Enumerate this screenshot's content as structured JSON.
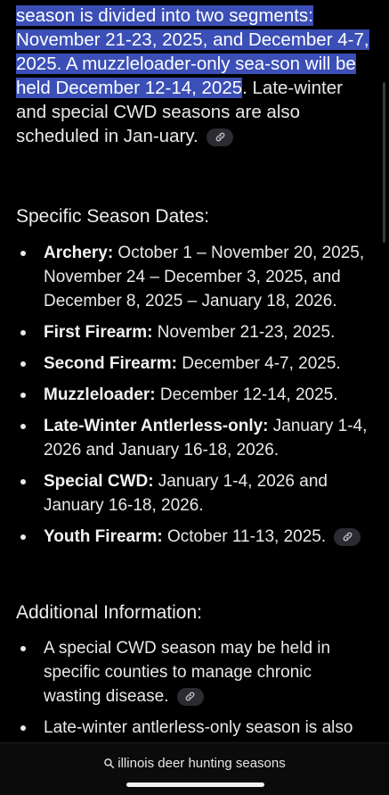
{
  "intro": {
    "highlighted": "season is divided into two segments: November 21-23, 2025, and December 4-7, 2025. A muzzleloader-only sea-son will be held December 12-14, 2025",
    "rest": ". Late-winter and special CWD seasons are also scheduled in Jan-uary."
  },
  "specific": {
    "heading": "Specific Season Dates:",
    "items": [
      {
        "label": "Archery:",
        "text": " October 1 – November 20, 2025, November 24 – December 3, 2025, and December 8, 2025 – January 18, 2026."
      },
      {
        "label": "First Firearm:",
        "text": " November 21-23, 2025."
      },
      {
        "label": "Second Firearm:",
        "text": " December 4-7, 2025."
      },
      {
        "label": "Muzzleloader:",
        "text": " December 12-14, 2025."
      },
      {
        "label": "Late-Winter Antlerless-only:",
        "text": " January 1-4, 2026 and January 16-18, 2026."
      },
      {
        "label": "Special CWD:",
        "text": " January 1-4, 2026 and January 16-18, 2026."
      },
      {
        "label": "Youth Firearm:",
        "text": " October 11-13, 2025."
      }
    ]
  },
  "additional": {
    "heading": "Additional Information:",
    "items": [
      {
        "text": "A special CWD season may be held in specific counties to manage chronic wasting disease."
      },
      {
        "text": "Late-winter antlerless-only season is also"
      }
    ]
  },
  "bottom_bar": {
    "search_query": "illinois deer hunting seasons"
  },
  "icons": {
    "link": "link-icon",
    "search": "search-icon"
  },
  "colors": {
    "background": "#000000",
    "highlight": "#3b4fb6",
    "chip": "#2b2c32"
  }
}
